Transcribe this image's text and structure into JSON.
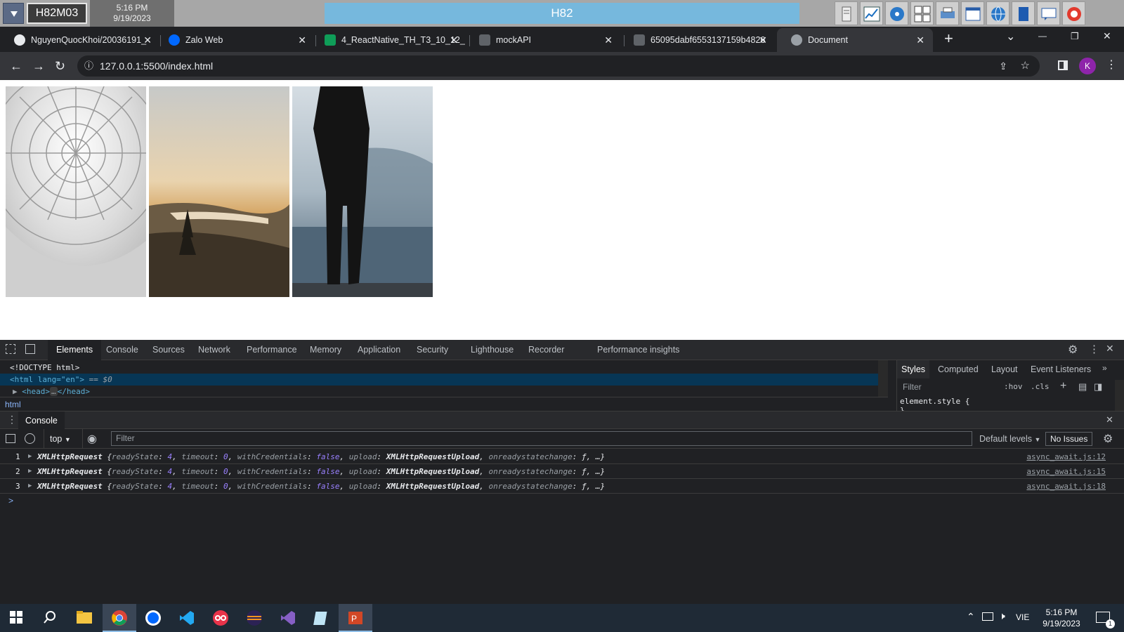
{
  "topbar": {
    "host": "H82M03",
    "time": "5:16 PM",
    "date": "9/19/2023",
    "center_title": "H82",
    "tray_icons": [
      "server-icon",
      "chart-icon",
      "disc-icon",
      "keyboard-icon",
      "printer-icon",
      "table-icon",
      "globe-icon",
      "book-icon",
      "message-icon",
      "lifebuoy-icon"
    ]
  },
  "tabs": [
    {
      "label": "NguyenQuocKhoi/20036191_",
      "icon": "github-icon",
      "close": "✕"
    },
    {
      "label": "Zalo Web",
      "icon": "zalo-icon",
      "close": "✕"
    },
    {
      "label": "4_ReactNative_TH_T3_10_12_",
      "icon": "sheets-icon",
      "close": "✕"
    },
    {
      "label": "mockAPI",
      "icon": "mockapi-icon",
      "close": "✕"
    },
    {
      "label": "65095dabf6553137159b4826",
      "icon": "mockapi-icon",
      "close": "✕"
    },
    {
      "label": "Document",
      "icon": "globe-icon",
      "close": "✕"
    }
  ],
  "tabstrip": {
    "new_tab": "+",
    "menu": "⌄",
    "minimize": "—",
    "restore": "❐",
    "close": "✕"
  },
  "addressbar": {
    "url": "127.0.0.1:5500/index.html",
    "profile": "K"
  },
  "photos": [
    "guggenheim-rotunda-photo",
    "valley-sunset-photo",
    "man-by-misty-lake-photo"
  ],
  "devtools": {
    "tabs": [
      "Elements",
      "Console",
      "Sources",
      "Network",
      "Performance",
      "Memory",
      "Application",
      "Security",
      "Lighthouse",
      "Recorder",
      "Performance insights"
    ],
    "active_tab": "Elements",
    "elements": {
      "line1": "<!DOCTYPE html>",
      "line2_tag": "<html lang=\"en\">",
      "line2_suffix": " == $0",
      "line3_open": "<head>",
      "line3_close": "</head>",
      "breadcrumb": "html"
    },
    "styles": {
      "tabs": [
        "Styles",
        "Computed",
        "Layout",
        "Event Listeners"
      ],
      "filter_placeholder": "Filter",
      "hov": ":hov",
      "cls": ".cls",
      "rule": "element.style {",
      "rule_end": "}"
    },
    "console": {
      "drawer_title": "Console",
      "context": "top",
      "filter_placeholder": "Filter",
      "levels": "Default levels",
      "issues": "No Issues",
      "prompt": ">",
      "rows": [
        {
          "num": "1",
          "src": "async_await.js:12"
        },
        {
          "num": "2",
          "src": "async_await.js:15"
        },
        {
          "num": "3",
          "src": "async_await.js:18"
        }
      ],
      "msg": {
        "type": "XMLHttpRequest",
        "readyState_key": "readyState",
        "readyState_val": "4",
        "timeout_key": "timeout",
        "timeout_val": "0",
        "withCredentials_key": "withCredentials",
        "withCredentials_val": "false",
        "upload_key": "upload",
        "upload_val": "XMLHttpRequestUpload",
        "onrsc_key": "onreadystatechange",
        "onrsc_val": "ƒ",
        "ellipsis": "…}"
      }
    }
  },
  "taskbar": {
    "apps": [
      "windows-start-icon",
      "search-icon",
      "file-explorer-icon",
      "chrome-icon",
      "zalo-icon",
      "vscode-icon",
      "app-red-icon",
      "eclipse-icon",
      "visual-studio-icon",
      "notepad-icon",
      "powerpoint-icon"
    ],
    "lang": "VIE",
    "time": "5:16 PM",
    "date": "9/19/2023",
    "notif_count": "1"
  }
}
